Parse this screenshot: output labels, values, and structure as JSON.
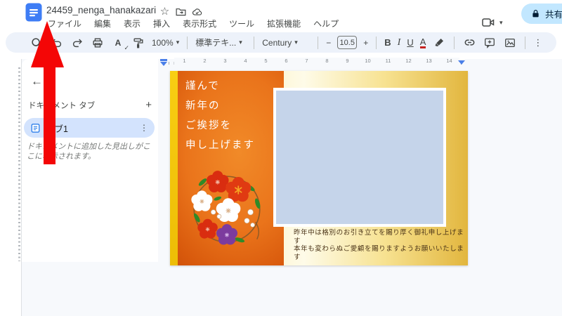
{
  "titlebar": {
    "title": "24459_nenga_hanakazari",
    "star_glyph": "☆",
    "menus": [
      "ファイル",
      "編集",
      "表示",
      "挿入",
      "表示形式",
      "ツール",
      "拡張機能",
      "ヘルプ"
    ],
    "share_label": "共有"
  },
  "toolbar": {
    "zoom_value": "100%",
    "styles_value": "標準テキ...",
    "font_value": "Century",
    "font_size_value": "10.5",
    "minus_glyph": "−",
    "plus_glyph": "+",
    "bold_glyph": "B",
    "italic_glyph": "I",
    "underline_glyph": "U",
    "text_color_glyph": "A",
    "spellcheck_glyph": "A",
    "spellcheck_check_glyph": "✓",
    "caret_glyph": "▾",
    "kebab_glyph": "⋮"
  },
  "sidebar": {
    "back_glyph": "←",
    "header": "ドキュメント タブ",
    "add_glyph": "+",
    "tab": {
      "label": "タブ1",
      "kebab_glyph": "⋮"
    },
    "helper_line1": "ドキュメントに追加した見出しがこ",
    "helper_line2": "こに表示されます。"
  },
  "ruler": {
    "numbers": [
      "1",
      "2",
      "3",
      "4",
      "5",
      "6",
      "7",
      "8",
      "9",
      "10",
      "11",
      "12",
      "13",
      "14"
    ]
  },
  "card": {
    "greeting_lines": [
      "謹んで",
      "新年の",
      "ご挨拶を",
      "申し上げます"
    ],
    "message_lines": [
      "昨年中は格別のお引き立てを賜り厚く御礼申し上げます",
      "本年も変わらぬご愛顧を賜りますようお願いいたします"
    ]
  },
  "colors": {
    "arrow": "#f40606",
    "docs_blue": "#3e7df5",
    "toolbar_bg": "#edf2fa",
    "share_bg": "#c2e7ff",
    "tab_pill_bg": "#d3e3fd",
    "canvas_bg": "#f7f9fc",
    "card_yellow": "#f5c70c",
    "card_orange": "#e06a12",
    "card_gold": "#f3d96e",
    "placeholder_fill": "#c5d4ea"
  }
}
